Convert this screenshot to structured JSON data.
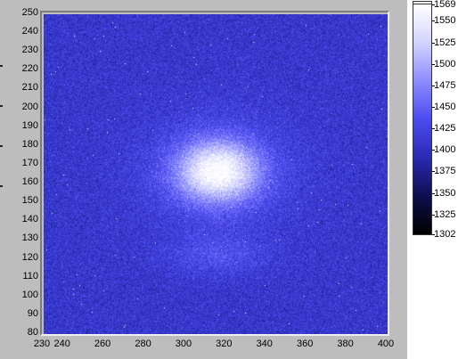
{
  "graph": {
    "x_axis": {
      "min": 230,
      "max": 400,
      "ticks": [
        "230",
        "240",
        "260",
        "280",
        "300",
        "320",
        "340",
        "360",
        "380",
        "400"
      ]
    },
    "y_axis": {
      "min": 80,
      "max": 250,
      "ticks": [
        "80",
        "90",
        "100",
        "110",
        "120",
        "130",
        "140",
        "150",
        "160",
        "170",
        "180",
        "190",
        "200",
        "210",
        "220",
        "230",
        "240",
        "250"
      ]
    },
    "colormap": [
      "#000000",
      "#0f0f50",
      "#2a2ab4",
      "#4c4cf0",
      "#8c8cff",
      "#d2d2ff",
      "#ffffff"
    ]
  },
  "colorbar": {
    "min": 1302,
    "max": 1569,
    "ticks": [
      "1569",
      "1550",
      "1525",
      "1500",
      "1475",
      "1450",
      "1425",
      "1400",
      "1375",
      "1350",
      "1325",
      "1302"
    ]
  }
}
